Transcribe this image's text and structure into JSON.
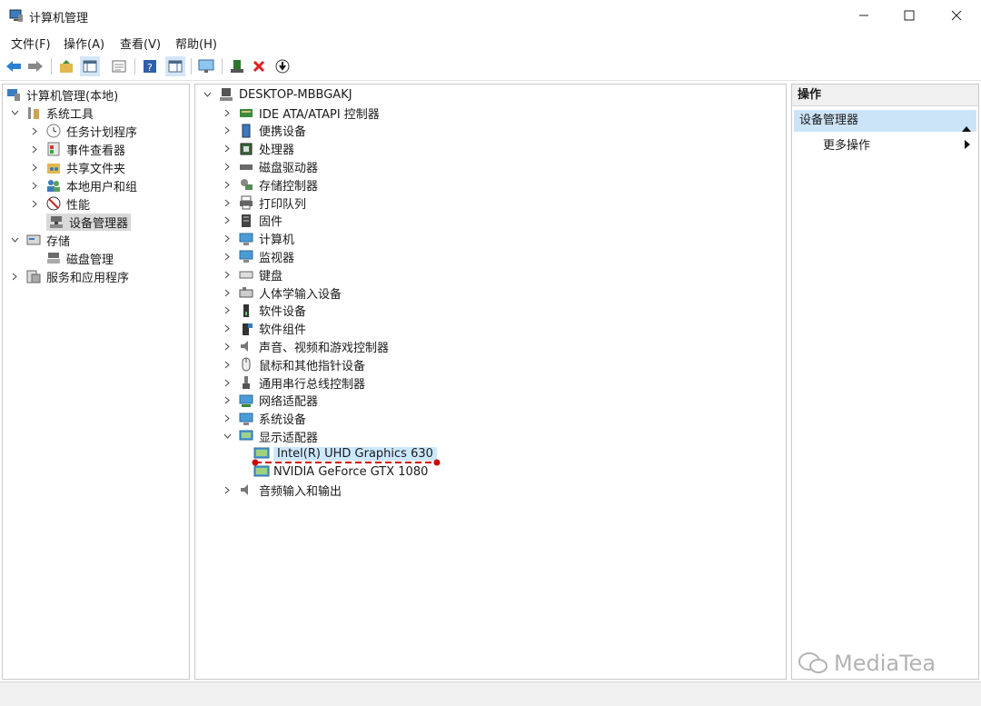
{
  "window": {
    "title": "计算机管理"
  },
  "menu": [
    "文件(F)",
    "操作(A)",
    "查看(V)",
    "帮助(H)"
  ],
  "left_tree": {
    "root": "计算机管理(本地)",
    "system_tools": "系统工具",
    "task_scheduler": "任务计划程序",
    "event_viewer": "事件查看器",
    "shared_folders": "共享文件夹",
    "local_users": "本地用户和组",
    "performance": "性能",
    "device_manager": "设备管理器",
    "storage": "存储",
    "disk_management": "磁盘管理",
    "services_apps": "服务和应用程序"
  },
  "device_tree": {
    "root": "DESKTOP-MBBGAKJ",
    "categories": [
      "IDE ATA/ATAPI 控制器",
      "便携设备",
      "处理器",
      "磁盘驱动器",
      "存储控制器",
      "打印队列",
      "固件",
      "计算机",
      "监视器",
      "键盘",
      "人体学输入设备",
      "软件设备",
      "软件组件",
      "声音、视频和游戏控制器",
      "鼠标和其他指针设备",
      "通用串行总线控制器",
      "网络适配器",
      "系统设备",
      "显示适配器"
    ],
    "display_adapters": [
      "Intel(R) UHD Graphics 630",
      "NVIDIA GeForce GTX 1080"
    ],
    "last_category": "音频输入和输出"
  },
  "actions": {
    "header": "操作",
    "item": "设备管理器",
    "more": "更多操作"
  },
  "watermark": "MediaTea",
  "colors": {
    "selection": "#cce8ff",
    "annotation": "#cc0000"
  }
}
